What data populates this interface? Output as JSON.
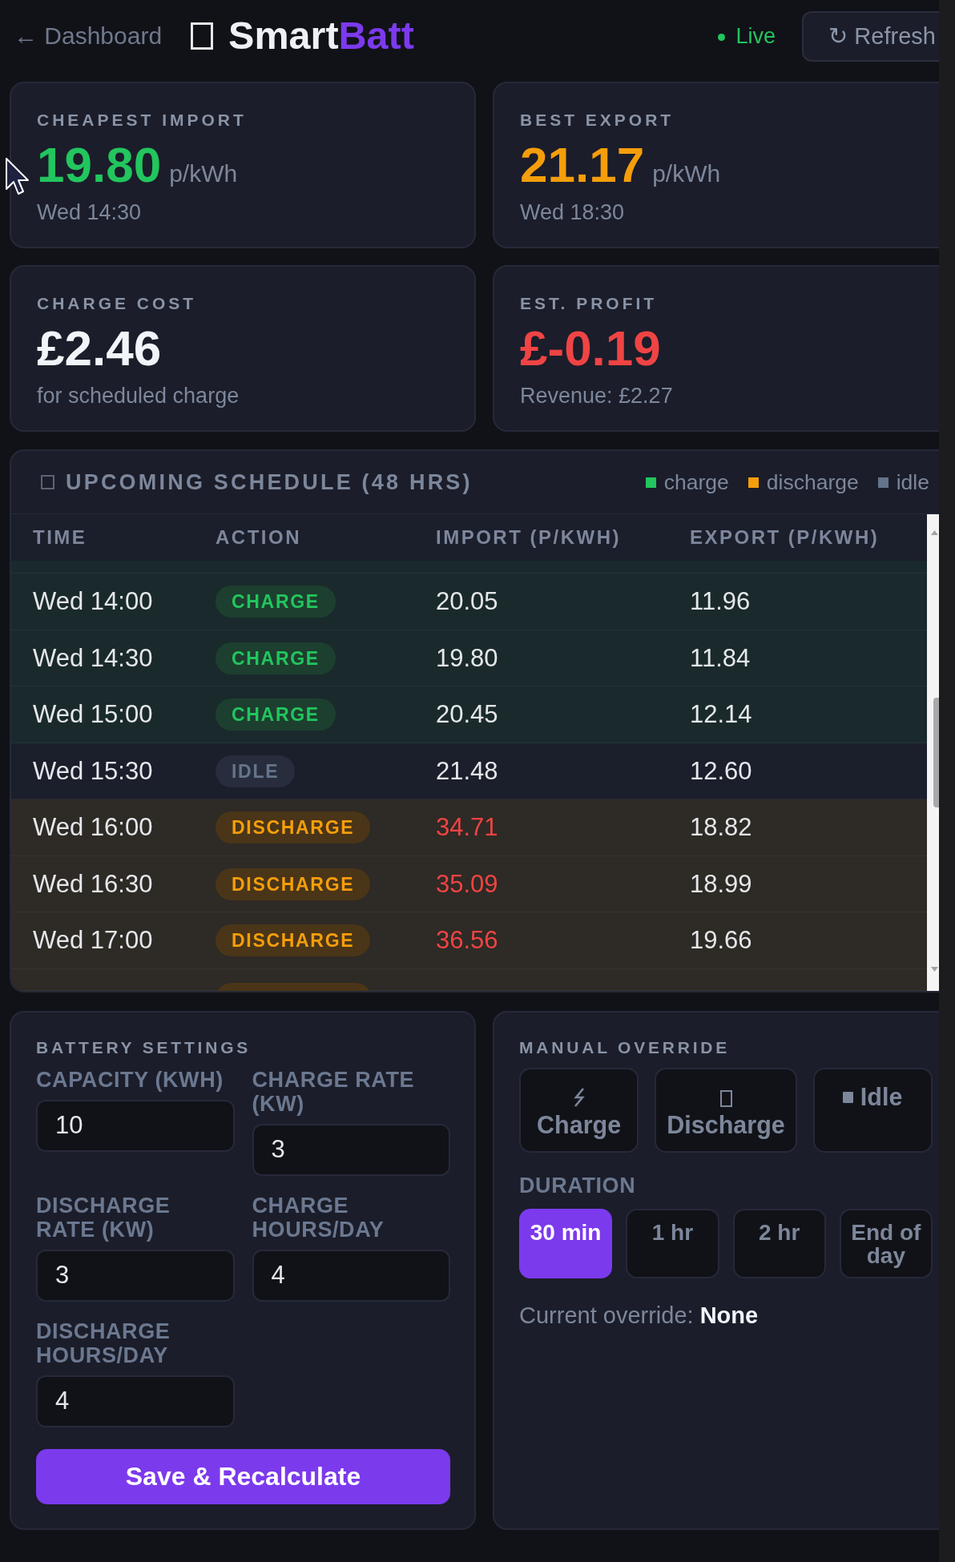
{
  "header": {
    "back_link": "← Dashboard",
    "title": {
      "text": "Smart",
      "accent": "Batt"
    },
    "status": "Live",
    "refresh_button": "↻ Refresh"
  },
  "stats": [
    {
      "label": "CHEAPEST IMPORT",
      "value": "19.80",
      "unit": "p/kWh",
      "note": "Wed 14:30",
      "color": "#22c55e"
    },
    {
      "label": "BEST EXPORT",
      "value": "21.17",
      "unit": "p/kWh",
      "note": "Wed 18:30",
      "color": "#f59e0b"
    },
    {
      "label": "CHARGE COST",
      "value": "£2.46",
      "note": "for scheduled charge",
      "color": "#f1f5f9"
    },
    {
      "label": "EST. PROFIT",
      "value": "£-0.19",
      "note": "Revenue: £2.27",
      "color": "#ef4444"
    }
  ],
  "schedule": {
    "title": "UPCOMING SCHEDULE (48 HRS)",
    "legend": [
      {
        "label": "charge",
        "color": "#22c55e"
      },
      {
        "label": "discharge",
        "color": "#f59e0b"
      },
      {
        "label": "idle",
        "color": "#64748b"
      }
    ],
    "columns": [
      "TIME",
      "ACTION",
      "IMPORT (P/KWH)",
      "EXPORT (P/KWH)"
    ],
    "edge_rows": {
      "top": {
        "kind": "charge"
      },
      "bottom": {
        "kind": "discharge"
      }
    },
    "rows": [
      {
        "time": "Wed 14:00",
        "action": {
          "kind": "charge",
          "label": "CHARGE"
        },
        "import": "20.05",
        "export": "11.96"
      },
      {
        "time": "Wed 14:30",
        "action": {
          "kind": "charge",
          "label": "CHARGE"
        },
        "import": "19.80",
        "export": "11.84"
      },
      {
        "time": "Wed 15:00",
        "action": {
          "kind": "charge",
          "label": "CHARGE"
        },
        "import": "20.45",
        "export": "12.14"
      },
      {
        "time": "Wed 15:30",
        "action": {
          "kind": "idle",
          "label": "IDLE"
        },
        "import": "21.48",
        "export": "12.60"
      },
      {
        "time": "Wed 16:00",
        "action": {
          "kind": "discharge",
          "label": "DISCHARGE"
        },
        "import": "34.71",
        "export": "18.82"
      },
      {
        "time": "Wed 16:30",
        "action": {
          "kind": "discharge",
          "label": "DISCHARGE"
        },
        "import": "35.09",
        "export": "18.99"
      },
      {
        "time": "Wed 17:00",
        "action": {
          "kind": "discharge",
          "label": "DISCHARGE"
        },
        "import": "36.56",
        "export": "19.66"
      }
    ]
  },
  "battery_settings": {
    "title": "BATTERY SETTINGS",
    "fields": [
      {
        "label": "CAPACITY (KWH)",
        "value": "10"
      },
      {
        "label": "CHARGE RATE (KW)",
        "value": "3"
      },
      {
        "label": "DISCHARGE RATE (KW)",
        "value": "3"
      },
      {
        "label": "CHARGE HOURS/DAY",
        "value": "4"
      },
      {
        "label": "DISCHARGE HOURS/DAY",
        "value": "4"
      }
    ],
    "save_button": "Save & Recalculate"
  },
  "manual_override": {
    "title": "MANUAL OVERRIDE",
    "modes": [
      {
        "kind": "charge",
        "label": "Charge"
      },
      {
        "kind": "discharge",
        "label": "Discharge"
      },
      {
        "kind": "idle",
        "label": "Idle"
      }
    ],
    "duration_label": "DURATION",
    "durations": [
      {
        "label": "30 min",
        "selected": true
      },
      {
        "label": "1 hr",
        "selected": false
      },
      {
        "label": "2 hr",
        "selected": false
      },
      {
        "label": "End of day",
        "selected": false
      }
    ],
    "status": "Current override: **None**"
  }
}
